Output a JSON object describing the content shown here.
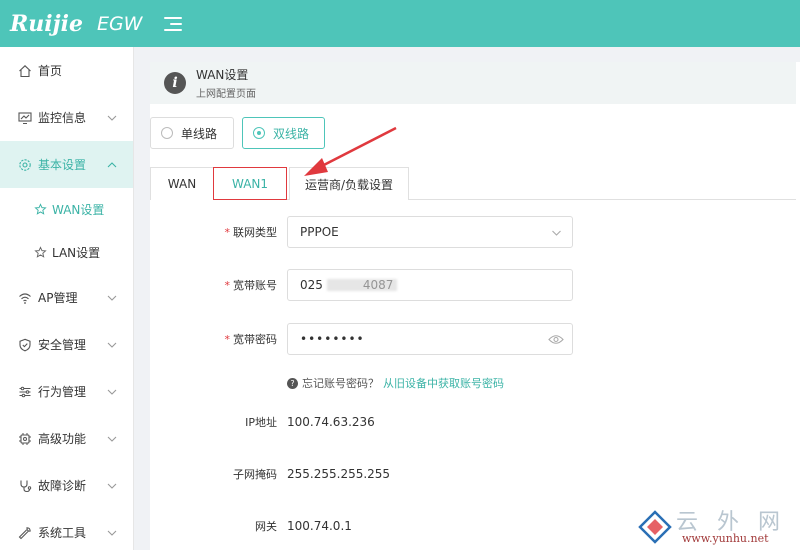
{
  "topbar": {
    "brand": "Ruijie",
    "product": "EGW",
    "bg_color": "#4ec5b9"
  },
  "sidebar": {
    "items": [
      {
        "label": "首页",
        "icon": "home-icon"
      },
      {
        "label": "监控信息",
        "icon": "monitor-icon"
      },
      {
        "label": "基本设置",
        "icon": "gear-icon",
        "expanded": true
      },
      {
        "label": "AP管理",
        "icon": "wifi-icon"
      },
      {
        "label": "安全管理",
        "icon": "shield-icon"
      },
      {
        "label": "行为管理",
        "icon": "sliders-icon"
      },
      {
        "label": "高级功能",
        "icon": "chip-icon"
      },
      {
        "label": "故障诊断",
        "icon": "stethoscope-icon"
      },
      {
        "label": "系统工具",
        "icon": "wrench-icon"
      }
    ],
    "subitems": [
      {
        "label": "WAN设置",
        "icon": "star-icon",
        "active": true
      },
      {
        "label": "LAN设置",
        "icon": "star-icon"
      }
    ]
  },
  "header": {
    "title": "WAN设置",
    "subtitle": "上网配置页面"
  },
  "line_mode": {
    "options": [
      "单线路",
      "双线路"
    ],
    "selected": "双线路"
  },
  "tabs": [
    "WAN",
    "WAN1",
    "运营商/负载设置"
  ],
  "form": {
    "conn_type": {
      "label": "联网类型",
      "value": "PPPOE"
    },
    "account": {
      "label": "宽带账号",
      "value_start": "025",
      "value_end": "4087"
    },
    "password": {
      "label": "宽带密码",
      "value": "••••••••"
    },
    "hint": "忘记账号密码？",
    "hint_link": "从旧设备中获取账号密码",
    "ip": {
      "label": "IP地址",
      "value": "100.74.63.236"
    },
    "mask": {
      "label": "子网掩码",
      "value": "255.255.255.255"
    },
    "gateway": {
      "label": "网关",
      "value": "100.74.0.1"
    }
  },
  "watermark": {
    "text": "云 外 网",
    "url": "www.yunhu.net"
  },
  "colors": {
    "accent": "#3bb3a6",
    "highlight": "#e0393e"
  }
}
